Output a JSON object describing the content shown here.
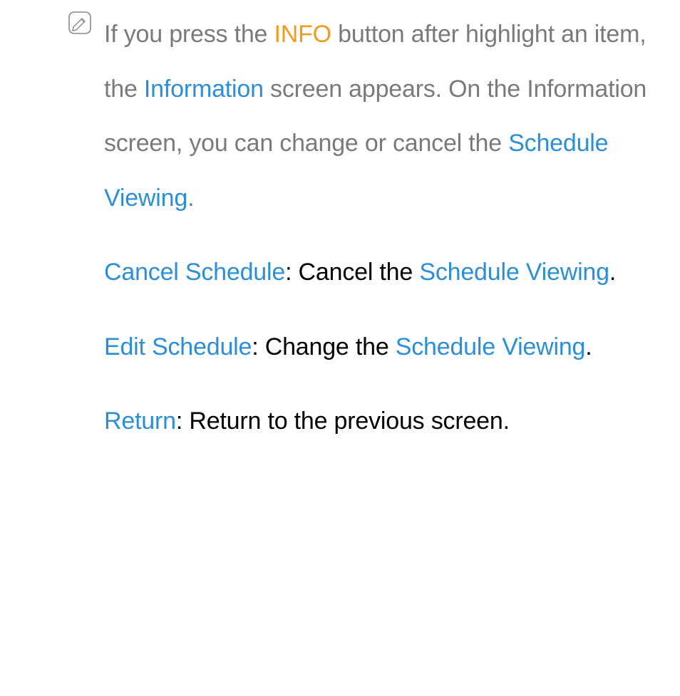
{
  "note": {
    "p1_a": "If you press the ",
    "p1_info": "INFO",
    "p1_b": " button after highlight an item, the ",
    "p1_information": "Information",
    "p1_c": " screen appears. On the Information screen, you can change or cancel the ",
    "p1_schedule_viewing": "Schedule Viewing",
    "p1_d": "."
  },
  "para2": {
    "label": "Cancel Schedule",
    "a": ": Cancel the ",
    "sv": "Schedule Viewing",
    "b": "."
  },
  "para3": {
    "label": "Edit Schedule",
    "a": ": Change the ",
    "sv": "Schedule Viewing",
    "b": "."
  },
  "para4": {
    "label": "Return",
    "a": ": Return to the previous screen."
  }
}
